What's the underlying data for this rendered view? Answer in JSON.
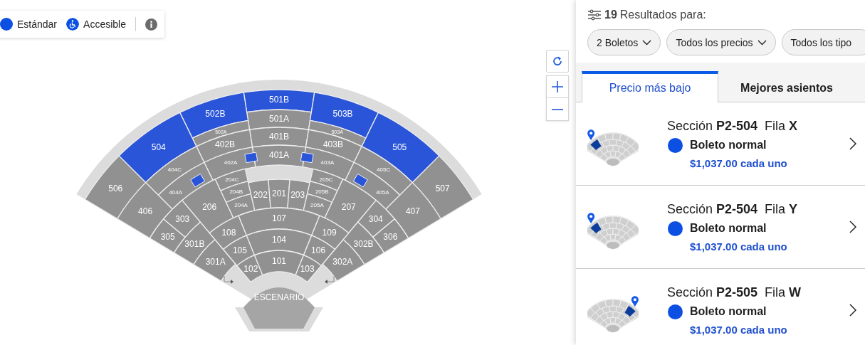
{
  "legend": [
    {
      "label": "Estándar",
      "kind": "standard",
      "color": "#0b4fe3"
    },
    {
      "label": "Accesible",
      "kind": "accessible",
      "color": "#0b4fe3"
    }
  ],
  "map": {
    "stage": "ESCENARIO",
    "sections": [
      {
        "label": "501B",
        "available": true
      },
      {
        "label": "501A",
        "available": false
      },
      {
        "label": "401B",
        "available": false
      },
      {
        "label": "401A",
        "available": false
      },
      {
        "label": "502B",
        "available": true
      },
      {
        "label": "502A",
        "available": false
      },
      {
        "label": "402B",
        "available": false
      },
      {
        "label": "402A",
        "available": false
      },
      {
        "label": "503B",
        "available": true
      },
      {
        "label": "503A",
        "available": false
      },
      {
        "label": "403B",
        "available": false
      },
      {
        "label": "403A",
        "available": false
      },
      {
        "label": "504",
        "available": true
      },
      {
        "label": "404C",
        "available": false
      },
      {
        "label": "404A",
        "available": false
      },
      {
        "label": "505",
        "available": true
      },
      {
        "label": "405C",
        "available": false
      },
      {
        "label": "405A",
        "available": false
      },
      {
        "label": "506",
        "available": false
      },
      {
        "label": "406",
        "available": false
      },
      {
        "label": "507",
        "available": false
      },
      {
        "label": "407",
        "available": false
      },
      {
        "label": "206",
        "available": false
      },
      {
        "label": "204C",
        "available": false
      },
      {
        "label": "204B",
        "available": false
      },
      {
        "label": "204A",
        "available": false
      },
      {
        "label": "202",
        "available": false
      },
      {
        "label": "201",
        "available": false
      },
      {
        "label": "203",
        "available": false
      },
      {
        "label": "205C",
        "available": false
      },
      {
        "label": "205B",
        "available": false
      },
      {
        "label": "205A",
        "available": false
      },
      {
        "label": "207",
        "available": false
      },
      {
        "label": "305",
        "available": false
      },
      {
        "label": "303",
        "available": false
      },
      {
        "label": "304",
        "available": false
      },
      {
        "label": "306",
        "available": false
      },
      {
        "label": "301B",
        "available": false
      },
      {
        "label": "301A",
        "available": false
      },
      {
        "label": "302B",
        "available": false
      },
      {
        "label": "302A",
        "available": false
      },
      {
        "label": "108",
        "available": false
      },
      {
        "label": "107",
        "available": false
      },
      {
        "label": "109",
        "available": false
      },
      {
        "label": "105",
        "available": false
      },
      {
        "label": "104",
        "available": false
      },
      {
        "label": "106",
        "available": false
      },
      {
        "label": "102",
        "available": false
      },
      {
        "label": "101",
        "available": false
      },
      {
        "label": "103",
        "available": false
      }
    ]
  },
  "results": {
    "count": "19",
    "label": "Resultados para:"
  },
  "filters": [
    {
      "label": "2 Boletos"
    },
    {
      "label": "Todos los precios"
    },
    {
      "label": "Todos los tipo"
    }
  ],
  "tabs": [
    {
      "label": "Precio más bajo",
      "selected": true
    },
    {
      "label": "Mejores asientos",
      "selected": false
    }
  ],
  "listings": [
    {
      "title": "Sección **P2-504**  Fila **X**",
      "ticket_type": "Boleto normal",
      "price": "$1,037.00 cada uno",
      "color": "#0b4fe3",
      "marker_right": false
    },
    {
      "title": "Sección **P2-504**  Fila **Y**",
      "ticket_type": "Boleto normal",
      "price": "$1,037.00 cada uno",
      "color": "#0b4fe3",
      "marker_right": false
    },
    {
      "title": "Sección **P2-505**  Fila **W**",
      "ticket_type": "Boleto normal",
      "price": "$1,037.00 cada uno",
      "color": "#0b4fe3",
      "marker_right": true
    }
  ]
}
